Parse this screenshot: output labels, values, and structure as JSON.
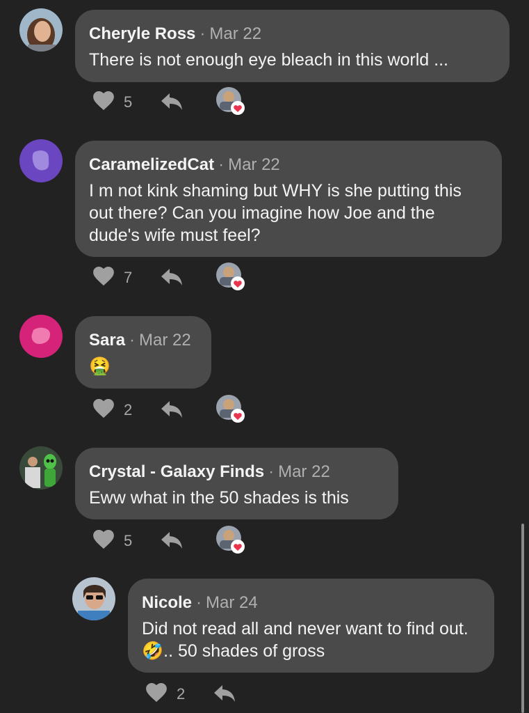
{
  "comments": [
    {
      "author": "Cheryle Ross",
      "date": "Mar 22",
      "text": "There is not enough eye bleach in this world ...",
      "likes": "5",
      "avatar": "photo-woman-avatar",
      "has_reactor": true
    },
    {
      "author": "CaramelizedCat",
      "date": "Mar 22",
      "text": "I m not kink shaming but WHY is she putting this out there? Can you imagine how Joe and the dude's wife must feel?",
      "likes": "7",
      "avatar": "purple-blob-avatar",
      "avatar_color": "#6b46c1",
      "has_reactor": true
    },
    {
      "author": "Sara",
      "date": "Mar 22",
      "text": "🤮",
      "likes": "2",
      "avatar": "pink-blob-avatar",
      "avatar_color": "#d6237a",
      "has_reactor": true
    },
    {
      "author": "Crystal - Galaxy Finds",
      "date": "Mar 22",
      "text": "Eww what in the 50 shades is this",
      "likes": "5",
      "avatar": "photo-alien-avatar",
      "has_reactor": true
    },
    {
      "author": "Nicole",
      "date": "Mar 24",
      "text": "Did not read all and never want to find out.🤣.. 50 shades of gross",
      "likes": "2",
      "avatar": "photo-sunglasses-avatar",
      "has_reactor": false
    }
  ],
  "separator": "·",
  "colors": {
    "background": "#222222",
    "bubble": "#4a4a4a",
    "icon": "#a0a0a0",
    "heart_reaction": "#e8344e"
  },
  "icons": {
    "like": "heart-icon",
    "reply": "reply-arrow-icon",
    "reaction": "heart-reaction-badge-icon"
  }
}
